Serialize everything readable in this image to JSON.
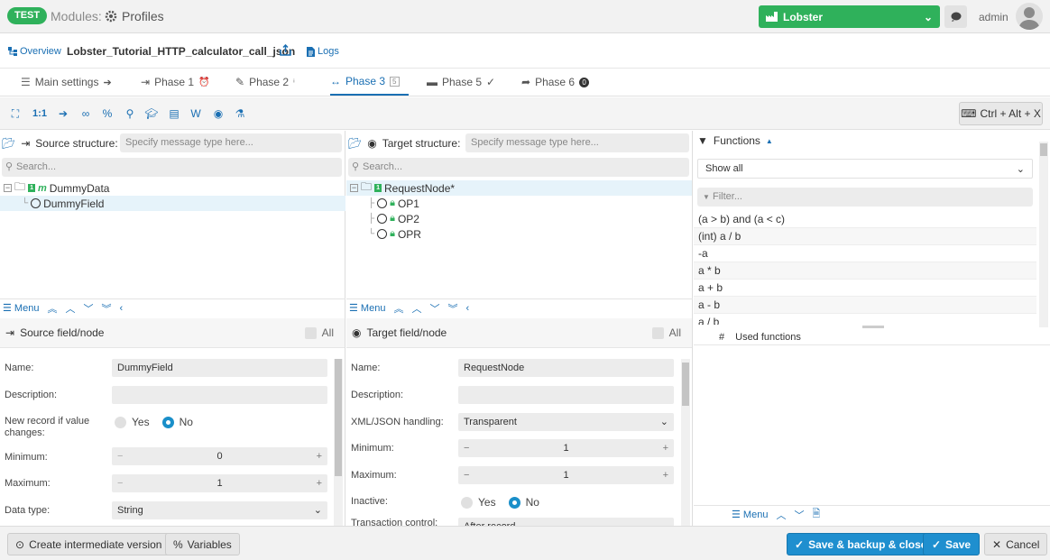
{
  "header": {
    "env_badge": "TEST",
    "modules_label": "Modules:",
    "profiles_label": "Profiles",
    "tenant": "Lobster",
    "user": "admin"
  },
  "profile_bar": {
    "overview_label": "Overview",
    "profile_name": "Lobster_Tutorial_HTTP_calculator_call_json",
    "logs_label": "Logs"
  },
  "tabs": [
    {
      "label": "Main settings"
    },
    {
      "label": "Phase 1"
    },
    {
      "label": "Phase 2"
    },
    {
      "label": "Phase 3",
      "badge": "5"
    },
    {
      "label": "Phase 5"
    },
    {
      "label": "Phase 6",
      "badge": "0"
    }
  ],
  "toolbar": {
    "ratio_label": "1:1",
    "shortcut_label": "Ctrl + Alt + X"
  },
  "source": {
    "title": "Source structure:",
    "msgtype_placeholder": "Specify message type here...",
    "search_placeholder": "Search...",
    "tree": [
      {
        "label": "DummyData"
      },
      {
        "label": "DummyField"
      }
    ],
    "menu_label": "Menu",
    "detail_title": "Source field/node",
    "all_label": "All",
    "fields": {
      "name_label": "Name:",
      "name_value": "DummyField",
      "description_label": "Description:",
      "new_record_label": "New record if value changes:",
      "yes_label": "Yes",
      "no_label": "No",
      "minimum_label": "Minimum:",
      "minimum_value": "0",
      "maximum_label": "Maximum:",
      "maximum_value": "1",
      "datatype_label": "Data type:",
      "datatype_value": "String"
    }
  },
  "target": {
    "title": "Target structure:",
    "msgtype_placeholder": "Specify message type here...",
    "search_placeholder": "Search...",
    "tree": [
      {
        "label": "RequestNode*"
      },
      {
        "label": "OP1"
      },
      {
        "label": "OP2"
      },
      {
        "label": "OPR"
      }
    ],
    "menu_label": "Menu",
    "detail_title": "Target field/node",
    "all_label": "All",
    "fields": {
      "name_label": "Name:",
      "name_value": "RequestNode",
      "description_label": "Description:",
      "xml_label": "XML/JSON handling:",
      "xml_value": "Transparent",
      "minimum_label": "Minimum:",
      "minimum_value": "1",
      "maximum_label": "Maximum:",
      "maximum_value": "1",
      "inactive_label": "Inactive:",
      "yes_label": "Yes",
      "no_label": "No",
      "transaction_label": "Transaction control:",
      "transaction_value": "After record"
    }
  },
  "functions": {
    "title": "Functions",
    "show_all": "Show all",
    "filter_placeholder": "Filter...",
    "items": [
      "(a > b) and (a < c)",
      "(int) a / b",
      "-a",
      "a * b",
      "a + b",
      "a - b",
      "a / b"
    ],
    "used_header_hash": "#",
    "used_header": "Used functions",
    "menu_label": "Menu"
  },
  "bottom": {
    "intermediate_label": "Create intermediate version",
    "variables_label": "Variables",
    "save_backup_label": "Save & backup & close",
    "save_label": "Save",
    "cancel_label": "Cancel"
  },
  "colors": {
    "brand_green": "#2fb15b",
    "accent_blue": "#1a6fb3",
    "button_blue": "#1f8fcf"
  }
}
